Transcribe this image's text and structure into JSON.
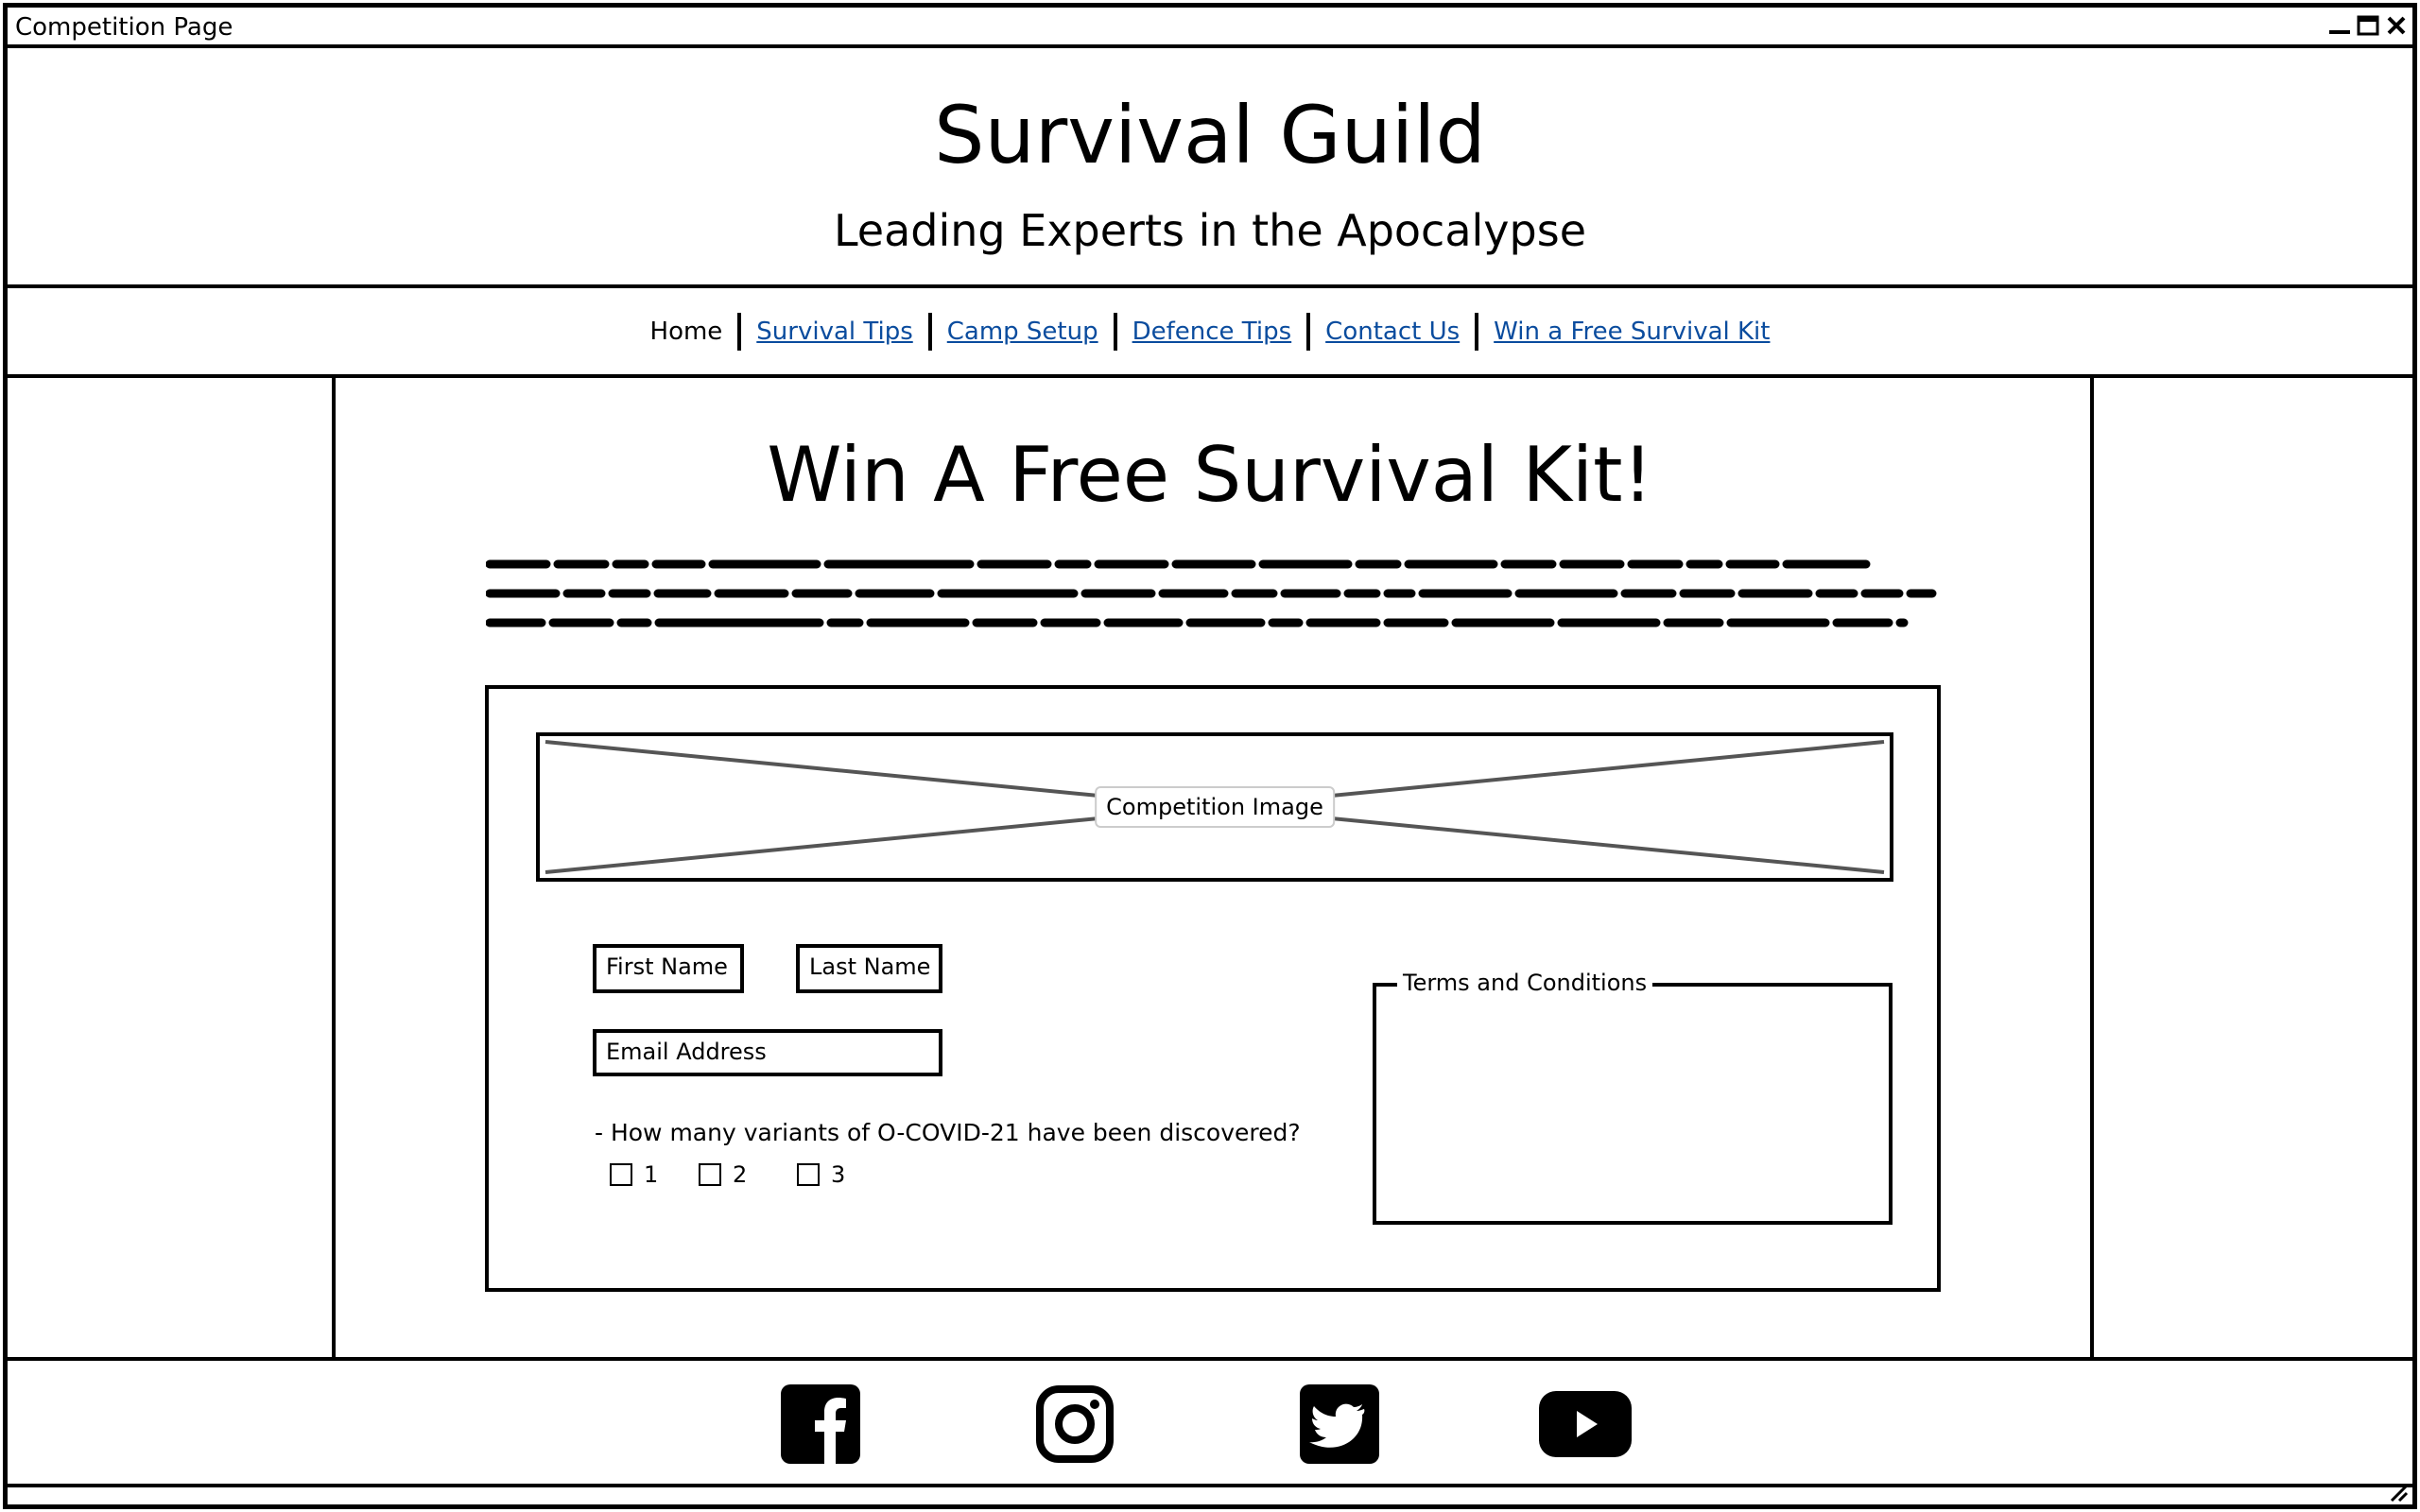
{
  "window": {
    "title": "Competition Page"
  },
  "header": {
    "site_title": "Survival Guild",
    "tagline": "Leading Experts in the Apocalypse"
  },
  "nav": {
    "items": [
      {
        "label": "Home",
        "is_link": false
      },
      {
        "label": "Survival Tips",
        "is_link": true
      },
      {
        "label": "Camp Setup",
        "is_link": true
      },
      {
        "label": "Defence Tips",
        "is_link": true
      },
      {
        "label": "Contact Us",
        "is_link": true
      },
      {
        "label": "Win a Free Survival Kit",
        "is_link": true
      }
    ]
  },
  "main": {
    "heading": "Win A Free Survival Kit!",
    "competition": {
      "image_label": "Competition Image",
      "first_name_placeholder": "First Name",
      "last_name_placeholder": "Last Name",
      "email_placeholder": "Email Address",
      "question": "- How many variants of O-COVID-21 have been discovered?",
      "options": [
        "1",
        "2",
        "3"
      ],
      "terms_title": "Terms and Conditions"
    }
  },
  "footer": {
    "social": [
      "facebook-icon",
      "instagram-icon",
      "twitter-icon",
      "youtube-icon"
    ]
  },
  "colors": {
    "link": "#0a4c9e",
    "border": "#000000",
    "placeholder_x": "#555555"
  }
}
